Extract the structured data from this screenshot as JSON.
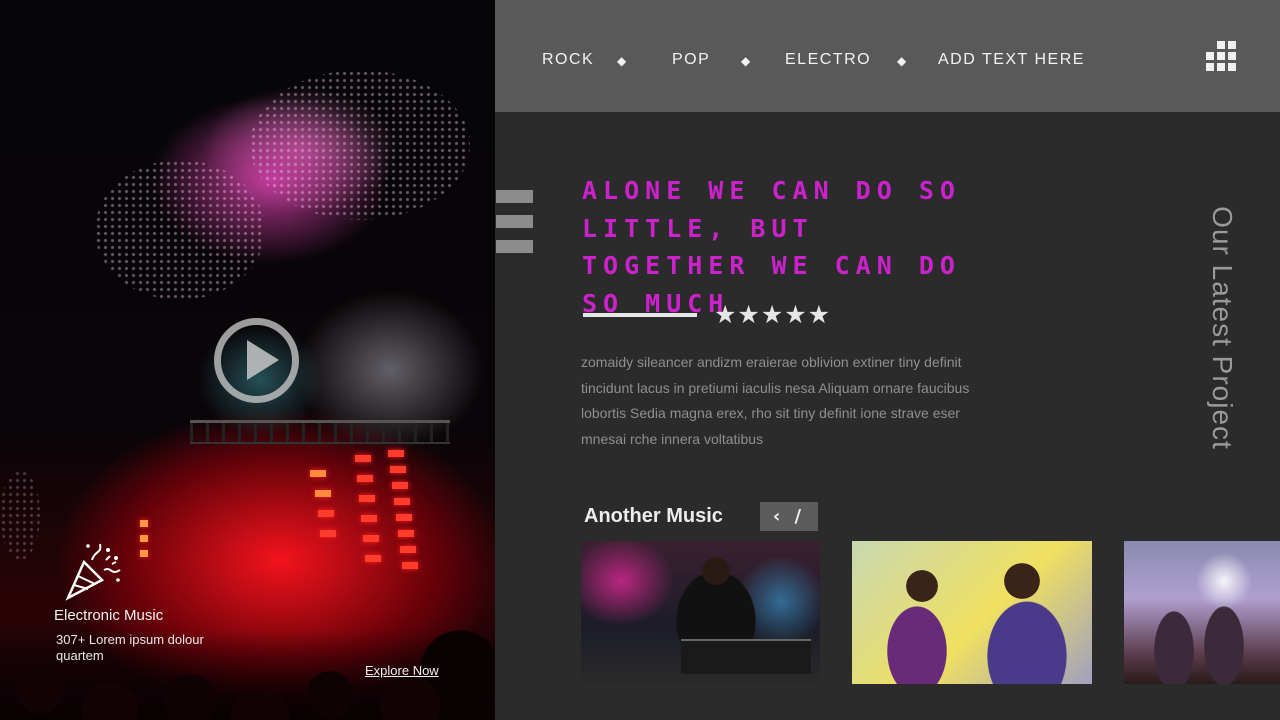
{
  "nav": {
    "items": [
      "ROCK",
      "POP",
      "ELECTRO",
      "ADD TEXT HERE"
    ],
    "separator": "◆"
  },
  "hero": {
    "title": "Electronic Music",
    "description": "307+ Lorem ipsum dolour quartem",
    "explore_label": "Explore Now"
  },
  "main": {
    "quote": "ALONE WE CAN DO SO LITTLE, BUT TOGETHER WE CAN DO SO MUCH",
    "stars": "★★★★★",
    "rating": 5,
    "body": "zomaidy sileancer andizm eraierae oblivion extiner tiny definit tincidunt lacus in pretiumi iaculis nesa Aliquam ornare faucibus lobortis Sedia magna erex, rho sit tiny definit ione strave eser mnesai rche innera voltatibus",
    "vertical_title": "Our Latest Project"
  },
  "another": {
    "title": "Another Music",
    "nav_label": "‹ /"
  },
  "colors": {
    "accent": "#cc22cc",
    "topbar": "#595959",
    "background": "#2b2b2b"
  }
}
